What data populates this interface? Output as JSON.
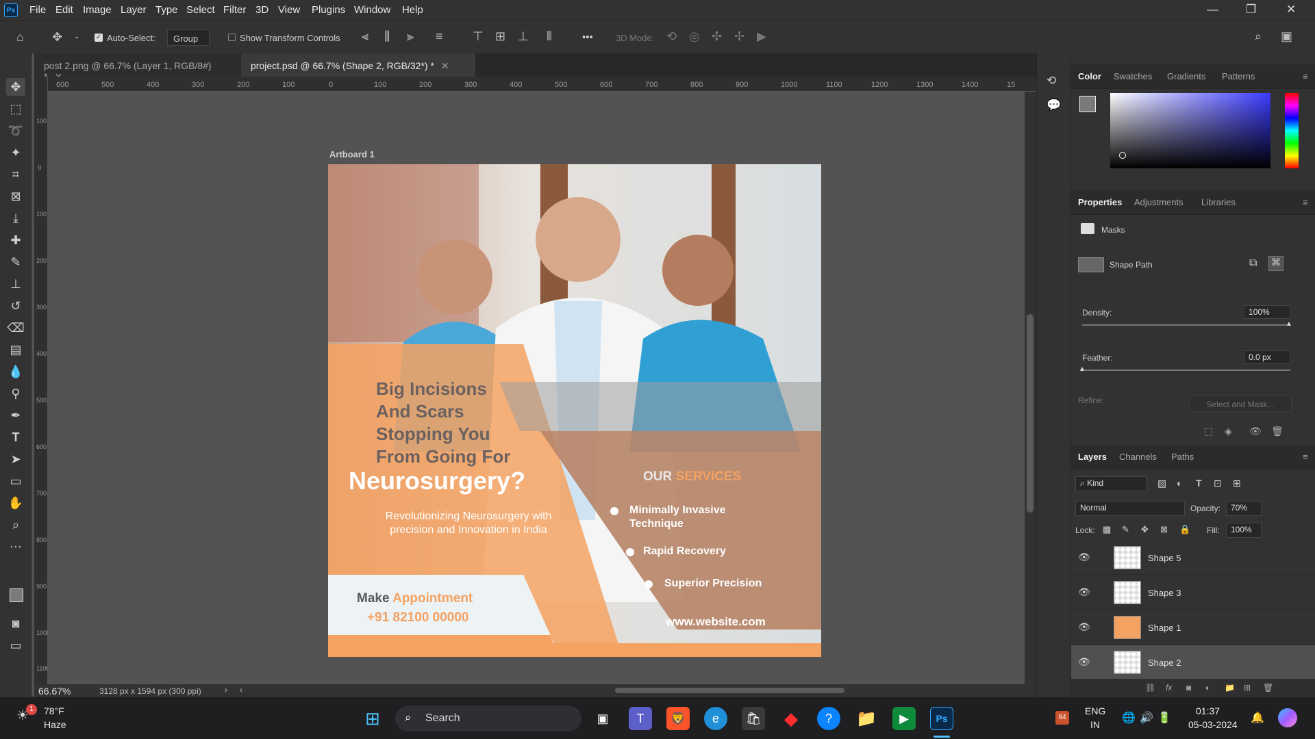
{
  "app": {
    "logo": "Ps"
  },
  "menu": [
    "File",
    "Edit",
    "Image",
    "Layer",
    "Type",
    "Select",
    "Filter",
    "3D",
    "View",
    "Plugins",
    "Window",
    "Help"
  ],
  "window_controls": {
    "minimize": "—",
    "restore": "❐",
    "close": "✕"
  },
  "options_bar": {
    "auto_select_label": "Auto-Select:",
    "auto_select_checked": true,
    "auto_select_target": "Group",
    "show_transform_controls": "Show Transform Controls",
    "more": "•••",
    "mode_3d": "3D Mode:"
  },
  "tabs": [
    {
      "label": "post 2.png @ 66.7% (Layer 1, RGB/8#) *",
      "active": false
    },
    {
      "label": "project.psd @ 66.7% (Shape 2, RGB/32*) *",
      "active": true
    }
  ],
  "ruler": {
    "h_ticks": [
      "600",
      "500",
      "400",
      "300",
      "200",
      "100",
      "0",
      "100",
      "200",
      "300",
      "400",
      "500",
      "600",
      "700",
      "800",
      "900",
      "1000",
      "1100",
      "1200",
      "1300",
      "1400",
      "15"
    ],
    "v_ticks": [
      "100",
      "0",
      "100",
      "200",
      "300",
      "400",
      "500",
      "600",
      "700",
      "800",
      "900",
      "1000",
      "1100"
    ]
  },
  "artboard": {
    "label": "Artboard 1",
    "headline": [
      "Big Incisions",
      "And Scars",
      "Stopping You",
      "From Going For"
    ],
    "headline_big": "Neurosurgery?",
    "sub": [
      "Revolutionizing Neurosurgery with",
      "precision and Innovation in India"
    ],
    "services_title_a": "OUR",
    "services_title_b": "SERVICES",
    "services": [
      "Minimally Invasive Technique",
      "Rapid Recovery",
      "Superior Precision"
    ],
    "website": "www.website.com",
    "cta_a": "Make",
    "cta_b": "Appointment",
    "phone": "+91 82100 00000",
    "colors": {
      "orange": "#f4a261",
      "brown": "#b8876a",
      "dark": "#5a5a5a"
    }
  },
  "status": {
    "zoom": "66.67%",
    "doc_info": "3128 px x 1594 px (300 ppi)"
  },
  "color_panel": {
    "tabs": [
      "Color",
      "Swatches",
      "Gradients",
      "Patterns"
    ],
    "active": "Color"
  },
  "properties_panel": {
    "tabs": [
      "Properties",
      "Adjustments",
      "Libraries"
    ],
    "masks": "Masks",
    "shape_path": "Shape Path",
    "density_label": "Density:",
    "density_value": "100%",
    "feather_label": "Feather:",
    "feather_value": "0.0 px",
    "refine_label": "Refine:",
    "select_and_mask": "Select and Mask..."
  },
  "layers_panel": {
    "tabs": [
      "Layers",
      "Channels",
      "Paths"
    ],
    "kind": "Kind",
    "blend_mode": "Normal",
    "opacity_label": "Opacity:",
    "opacity_value": "70%",
    "lock_label": "Lock:",
    "fill_label": "Fill:",
    "fill_value": "100%",
    "layers": [
      {
        "name": "Shape 5",
        "selected": false
      },
      {
        "name": "Shape 3",
        "selected": false
      },
      {
        "name": "Shape 1",
        "selected": false
      },
      {
        "name": "Shape 2",
        "selected": true
      }
    ]
  },
  "taskbar": {
    "weather_temp": "78°F",
    "weather_desc": "Haze",
    "weather_badge": "1",
    "search_label": "Search",
    "lang_a": "ENG",
    "lang_b": "IN",
    "time": "01:37",
    "date": "05-03-2024",
    "tray_badge": "84"
  }
}
